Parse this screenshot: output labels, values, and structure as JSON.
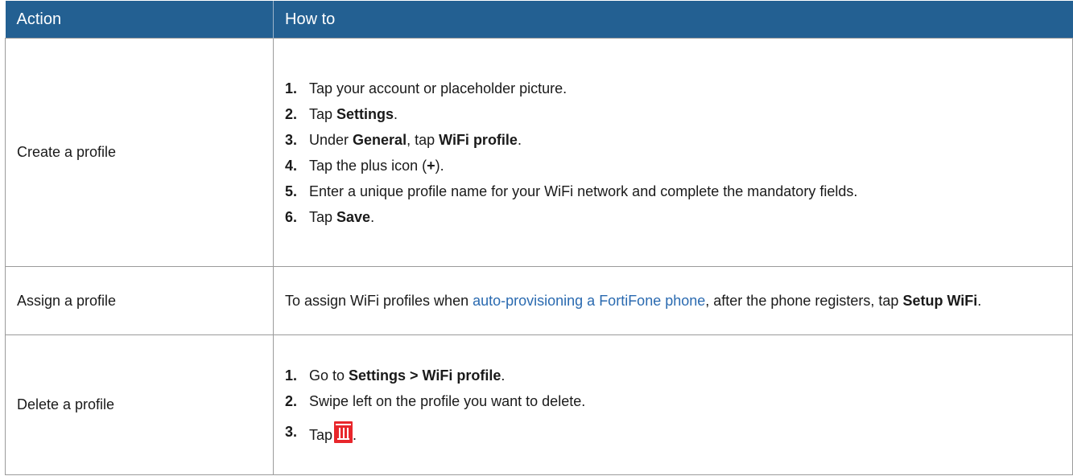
{
  "colors": {
    "header_bg": "#236092",
    "header_text": "#ffffff",
    "link": "#2a6ab0",
    "trash_icon": "#e8262b"
  },
  "table": {
    "headers": [
      "Action",
      "How to"
    ],
    "rows": [
      {
        "action": "Create a profile",
        "steps": [
          {
            "num": "1.",
            "parts": [
              "Tap your account or placeholder picture."
            ]
          },
          {
            "num": "2.",
            "parts": [
              "Tap ",
              "Settings",
              "."
            ]
          },
          {
            "num": "3.",
            "parts": [
              "Under ",
              "General",
              ", tap ",
              "WiFi profile",
              "."
            ]
          },
          {
            "num": "4.",
            "parts": [
              "Tap the plus icon (",
              "+",
              ")."
            ]
          },
          {
            "num": "5.",
            "parts": [
              "Enter a unique profile name for your WiFi network and complete the mandatory fields."
            ]
          },
          {
            "num": "6.",
            "parts": [
              "Tap ",
              "Save",
              "."
            ]
          }
        ]
      },
      {
        "action": "Assign a profile",
        "text_before": "To assign WiFi profiles when ",
        "link": "auto-provisioning a FortiFone phone",
        "text_middle": ", after the phone registers, tap ",
        "bold": "Setup WiFi",
        "text_after": "."
      },
      {
        "action": "Delete a profile",
        "steps": [
          {
            "num": "1.",
            "parts": [
              "Go to ",
              "Settings > WiFi profile",
              "."
            ]
          },
          {
            "num": "2.",
            "parts": [
              "Swipe left on the profile you want to delete."
            ]
          },
          {
            "num": "3.",
            "parts": [
              "Tap",
              "."
            ],
            "icon": "trash-icon"
          }
        ]
      }
    ]
  }
}
